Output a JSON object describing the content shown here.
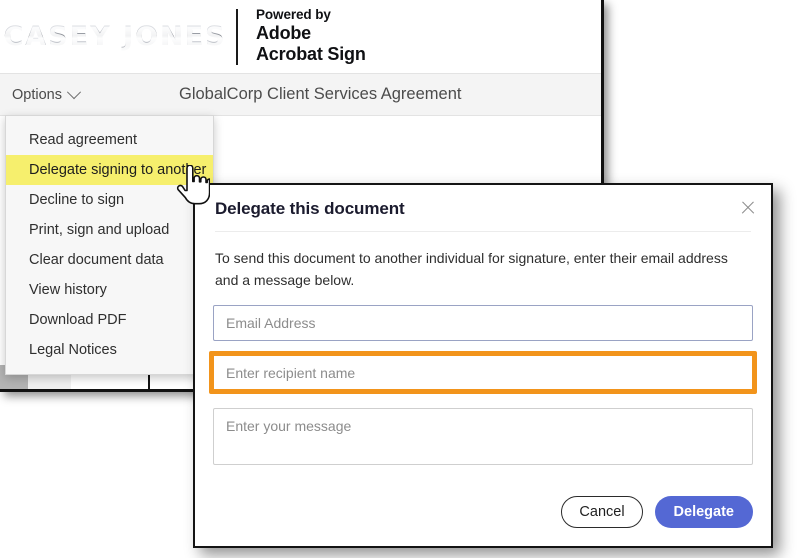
{
  "brand": {
    "logo_text": "CASEY JONES",
    "powered_by": "Powered by",
    "adobe": "Adobe",
    "product": "Acrobat Sign"
  },
  "toolbar": {
    "options_label": "Options",
    "chevron_icon": "chevron-down-icon",
    "document_title": "GlobalCorp Client Services Agreement"
  },
  "options_menu": {
    "items": [
      {
        "label": "Read agreement",
        "highlighted": false
      },
      {
        "label": "Delegate signing to another",
        "highlighted": true
      },
      {
        "label": "Decline to sign",
        "highlighted": false
      },
      {
        "label": "Print, sign and upload",
        "highlighted": false
      },
      {
        "label": "Clear document data",
        "highlighted": false
      },
      {
        "label": "View history",
        "highlighted": false
      },
      {
        "label": "Download PDF",
        "highlighted": false
      },
      {
        "label": "Legal Notices",
        "highlighted": false
      }
    ]
  },
  "cursor": {
    "icon": "hand-pointer-cursor"
  },
  "dialog": {
    "title": "Delegate this document",
    "close_icon": "close-icon",
    "description": "To send this document to another individual for signature, enter their email address and a message below.",
    "email_field": {
      "value": "",
      "placeholder": "Email Address"
    },
    "name_field": {
      "value": "",
      "placeholder": "Enter recipient name"
    },
    "message_field": {
      "value": "",
      "placeholder": "Enter your message"
    },
    "cancel_label": "Cancel",
    "delegate_label": "Delegate"
  },
  "colors": {
    "menu_highlight": "#F6EF6D",
    "field_highlight": "#F2941B",
    "primary_button": "#5468D4",
    "doc_mark": "#2A3A6B"
  }
}
